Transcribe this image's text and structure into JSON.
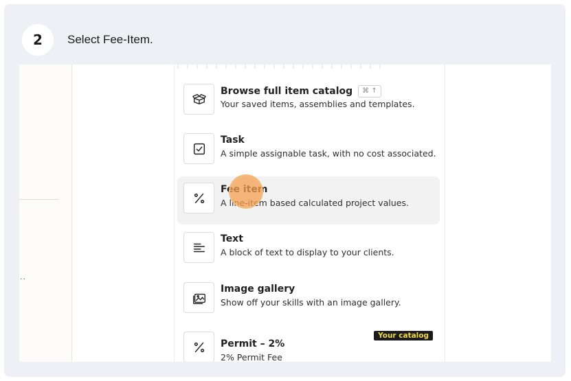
{
  "step": {
    "number": "2",
    "instruction": "Select Fee-Item."
  },
  "left_panel": {
    "ellipsis": ".."
  },
  "menu": {
    "items": [
      {
        "title": "Browse full item catalog",
        "shortcut": "⌘ ↑",
        "description": "Your saved items, assemblies and templates.",
        "icon": "box-catalog-icon"
      },
      {
        "title": "Task",
        "description": "A simple assignable task, with no cost associated.",
        "icon": "checkbox-icon"
      },
      {
        "title": "Fee item",
        "description": "A line-item based calculated project values.",
        "icon": "percent-icon"
      },
      {
        "title": "Text",
        "description": "A block of text to display to your clients.",
        "icon": "text-lines-icon"
      },
      {
        "title": "Image gallery",
        "description": "Show off your skills with an image gallery.",
        "icon": "image-gallery-icon"
      },
      {
        "title": "Permit – 2%",
        "description": "2% Permit Fee",
        "tag": "Your catalog",
        "icon": "percent-icon"
      }
    ]
  },
  "colors": {
    "tag_bg": "#1b1b1b",
    "tag_text": "#f1d84a",
    "cursor": "#f5a050",
    "active_row": "#f2f2f2"
  }
}
